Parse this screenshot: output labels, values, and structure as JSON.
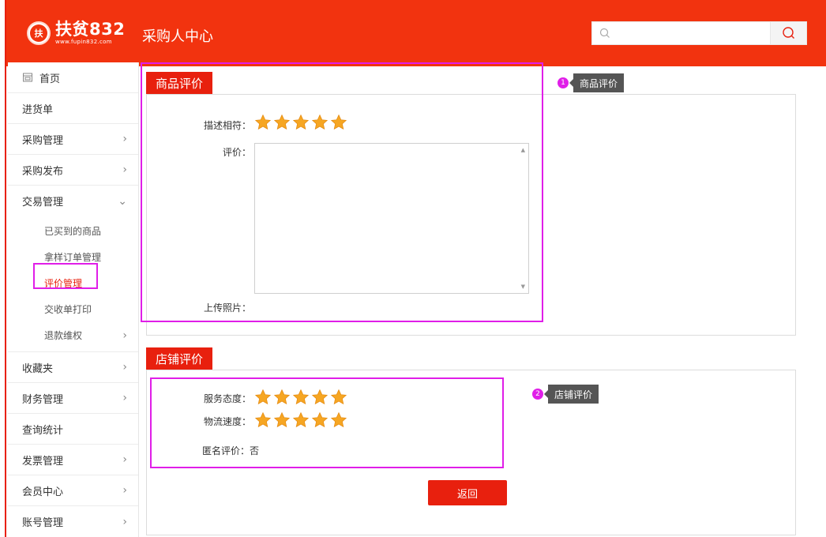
{
  "header": {
    "logo_main": "扶贫832",
    "logo_sub": "www.fupin832.com",
    "title": "采购人中心",
    "search_placeholder": ""
  },
  "sidebar": {
    "items": [
      {
        "label": "首页",
        "has_arrow": false
      },
      {
        "label": "进货单",
        "has_arrow": false
      },
      {
        "label": "采购管理",
        "has_arrow": true
      },
      {
        "label": "采购发布",
        "has_arrow": true
      },
      {
        "label": "交易管理",
        "has_arrow": true,
        "expanded": true
      }
    ],
    "trade_sub_items": [
      {
        "label": "已买到的商品"
      },
      {
        "label": "拿样订单管理"
      },
      {
        "label": "评价管理",
        "active": true
      },
      {
        "label": "交收单打印"
      },
      {
        "label": "退款维权",
        "has_arrow": true
      }
    ],
    "items_after": [
      {
        "label": "收藏夹"
      },
      {
        "label": "财务管理"
      },
      {
        "label": "查询统计"
      },
      {
        "label": "发票管理"
      },
      {
        "label": "会员中心"
      },
      {
        "label": "账号管理"
      }
    ]
  },
  "product_review": {
    "tag": "商品评价",
    "describe_label": "描述相符：",
    "describe_rating": 5,
    "comment_label": "评价：",
    "upload_label": "上传照片：",
    "callout_num": "1",
    "callout_text": "商品评价"
  },
  "shop_review": {
    "tag": "店铺评价",
    "service_label": "服务态度：",
    "service_rating": 5,
    "logistics_label": "物流速度：",
    "logistics_rating": 5,
    "anonymous_label": "匿名评价：否",
    "callout_num": "2",
    "callout_text": "店铺评价"
  },
  "back_button": "返回",
  "colors": {
    "brand_red": "#e8200e",
    "highlight": "#e01ee8",
    "star": "#f6a623"
  }
}
